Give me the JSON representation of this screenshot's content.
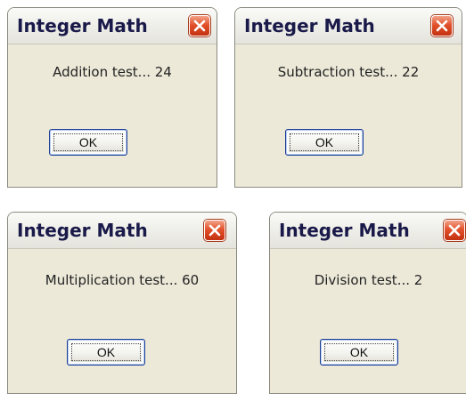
{
  "dialogs": [
    {
      "title": "Integer Math",
      "message": "Addition test... 24",
      "ok_label": "OK"
    },
    {
      "title": "Integer Math",
      "message": "Subtraction test... 22",
      "ok_label": "OK"
    },
    {
      "title": "Integer Math",
      "message": "Multiplication test... 60",
      "ok_label": "OK"
    },
    {
      "title": "Integer Math",
      "message": "Division test... 2",
      "ok_label": "OK"
    }
  ],
  "icons": {
    "close": "close-icon"
  },
  "colors": {
    "dialog_bg": "#ece9d8",
    "close_red": "#e3512c",
    "button_border": "#1c3f94"
  }
}
